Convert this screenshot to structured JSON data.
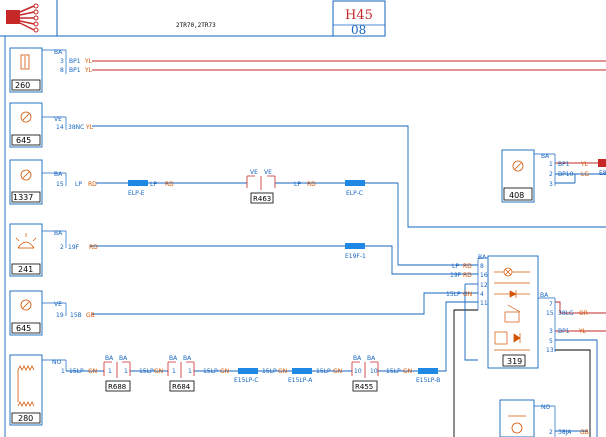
{
  "header": {
    "code": "H45",
    "subcode": "08",
    "center_text": "2TR70,2TR73"
  },
  "components": [
    {
      "id": "260",
      "pin_label": "BA",
      "pins": [
        "3",
        "8"
      ]
    },
    {
      "id": "645",
      "pin_label": "VE",
      "pins": [
        "14"
      ]
    },
    {
      "id": "1337",
      "pin_label": "BA",
      "pins": [
        "15"
      ]
    },
    {
      "id": "241",
      "pin_label": "BA",
      "pins": [
        "2"
      ]
    },
    {
      "id": "645",
      "pin_label": "VE",
      "pins": [
        "19"
      ]
    },
    {
      "id": "280",
      "pin_label": "NO",
      "pins": [
        "1"
      ]
    },
    {
      "id": "408",
      "pin_label": "BA",
      "pins": [
        "1",
        "2",
        "3"
      ]
    },
    {
      "id": "319",
      "pin_label": "BA",
      "pins_left": [
        "8",
        "16",
        "12",
        "4",
        "11"
      ],
      "pins_right": [
        "7",
        "15",
        "3",
        "5",
        "13"
      ]
    }
  ],
  "wires": {
    "w1": "BP1",
    "w1c": "YL",
    "w2": "BP1",
    "w2c": "YL",
    "w3": "38NC",
    "w3c": "YL",
    "w4c1": "LP",
    "w4c2": "RD",
    "w4c3": "RD",
    "w4c4": "LP",
    "w4c5": "RD",
    "w5": "19F",
    "w5c": "RD",
    "w6": "15B",
    "w6c": "GB",
    "w7": "15LP",
    "w7c": "GN",
    "r408_1": "BP1",
    "r408_1c": "YL",
    "r408_3": "BP10",
    "r408_3c": "LG",
    "r319_15": "38LG",
    "r319_15c": "OR",
    "r319_3": "BP1",
    "r319_3c": "YL",
    "in319_8": "LP",
    "in319_8c": "RD",
    "in319_16": "19F",
    "in319_16c": "RD",
    "in319_4": "15LP",
    "in319_4c": "GN",
    "bottom_w": "38JA",
    "bottom_wc": "GB"
  },
  "splices": {
    "s1": "ELP-E",
    "s2": "ELP-C",
    "s3": "E19F-1",
    "s4": "E15LP-C",
    "s5": "E15LP-A",
    "s6": "E15LP-B"
  },
  "relays": {
    "r463": "R463",
    "r463_pl": "VE",
    "r463_pr": "VE",
    "r688": "R688",
    "r688_pl": "BA",
    "r688_pr": "BA",
    "r684": "R684",
    "r684_pl": "BA",
    "r684_pr": "BA",
    "r455": "R455",
    "r455_pl": "BA",
    "r455_pr": "BA"
  },
  "chain": {
    "c1": "15LP",
    "c1c": "GN",
    "c2": "15LP",
    "c2c": "GN",
    "c3": "15LP",
    "c3c": "GN",
    "c4": "15LP",
    "c4c": "GN",
    "c5": "15LP",
    "c5c": "GN",
    "c6": "15LP",
    "c6c": "GN",
    "pin1": "1",
    "pin10": "10"
  },
  "misc": {
    "bottom_no": "NO",
    "bottom_pin": "2",
    "edge_label": "E8"
  },
  "colors": {
    "wire_red": "#c62828",
    "wire_blue": "#1565c0",
    "label_orange": "#d35400",
    "splice_blue": "#1e88e5"
  }
}
